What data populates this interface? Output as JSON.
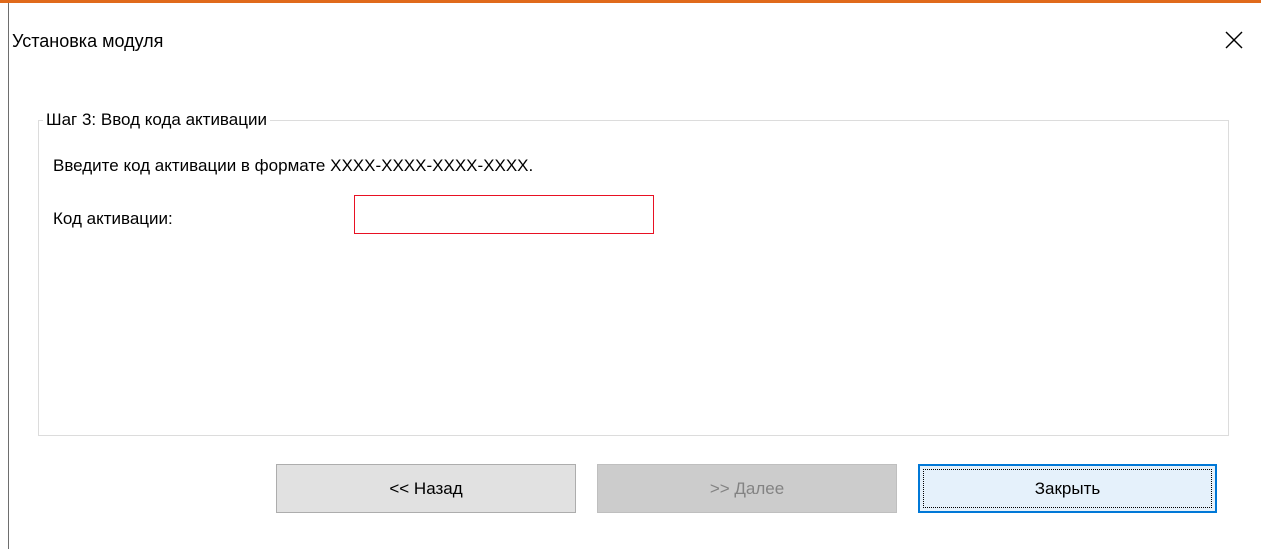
{
  "window": {
    "title": "Установка модуля",
    "accent_color": "#e06a1b"
  },
  "close_icon": "close-icon",
  "step_group": {
    "legend": "Шаг 3: Ввод кода активации",
    "instruction": "Введите код активации в формате XXXX-XXXX-XXXX-XXXX.",
    "code_label": "Код активации:",
    "code_value": "",
    "code_border_color": "#e81123"
  },
  "buttons": {
    "back_label": "<< Назад",
    "next_label": ">> Далее",
    "close_label": "Закрыть",
    "focus_color": "#0078d7"
  }
}
